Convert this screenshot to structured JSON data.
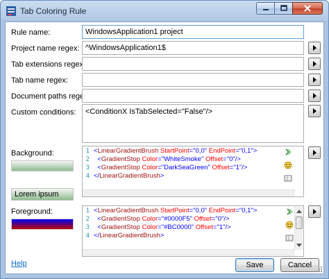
{
  "window": {
    "title": "Tab Coloring Rule"
  },
  "fields": {
    "rule_name": {
      "label": "Rule name:",
      "value": "WindowsApplication1 project"
    },
    "project_regex": {
      "label": "Project name regex:",
      "value": "^WindowsApplication1$"
    },
    "tab_ext_regex": {
      "label": "Tab extensions regex:",
      "value": ""
    },
    "tab_name_regex": {
      "label": "Tab name regex:",
      "value": ""
    },
    "doc_paths_regex": {
      "label": "Document paths regex:",
      "value": ""
    },
    "custom_conditions": {
      "label": "Custom conditions:",
      "value": "<ConditionX IsTabSelected=\"False\"/>"
    }
  },
  "background": {
    "label": "Background:",
    "sample_text": "Lorem ipsum",
    "line_numbers": [
      "1",
      "2",
      "3",
      "4"
    ],
    "lines": [
      [
        [
          "brk",
          "<"
        ],
        [
          "tag",
          "LinearGradientBrush"
        ],
        [
          "att",
          " StartPoint"
        ],
        [
          "brk",
          "=\""
        ],
        [
          "val",
          "0,0"
        ],
        [
          "brk",
          "\""
        ],
        [
          "att",
          " EndPoint"
        ],
        [
          "brk",
          "=\""
        ],
        [
          "val",
          "0,1"
        ],
        [
          "brk",
          "\">"
        ]
      ],
      [
        [
          "sp",
          "  "
        ],
        [
          "brk",
          "<"
        ],
        [
          "tag",
          "GradientStop"
        ],
        [
          "att",
          " Color"
        ],
        [
          "brk",
          "=\""
        ],
        [
          "val",
          "WhiteSmoke"
        ],
        [
          "brk",
          "\""
        ],
        [
          "att",
          " Offset"
        ],
        [
          "brk",
          "=\""
        ],
        [
          "val",
          "0"
        ],
        [
          "brk",
          "\"/>"
        ]
      ],
      [
        [
          "sp",
          "  "
        ],
        [
          "brk",
          "<"
        ],
        [
          "tag",
          "GradientStop"
        ],
        [
          "att",
          " Color"
        ],
        [
          "brk",
          "=\""
        ],
        [
          "val",
          "DarkSeaGreen"
        ],
        [
          "brk",
          "\""
        ],
        [
          "att",
          " Offset"
        ],
        [
          "brk",
          "=\""
        ],
        [
          "val",
          "1"
        ],
        [
          "brk",
          "\"/>"
        ]
      ],
      [
        [
          "brk",
          "</"
        ],
        [
          "tag",
          "LinearGradientBrush"
        ],
        [
          "brk",
          ">"
        ]
      ]
    ]
  },
  "foreground": {
    "label": "Foreground:",
    "line_numbers": [
      "1",
      "2",
      "3",
      "4"
    ],
    "lines": [
      [
        [
          "brk",
          "<"
        ],
        [
          "tag",
          "LinearGradientBrush"
        ],
        [
          "att",
          " StartPoint"
        ],
        [
          "brk",
          "=\""
        ],
        [
          "val",
          "0,0"
        ],
        [
          "brk",
          "\""
        ],
        [
          "att",
          " EndPoint"
        ],
        [
          "brk",
          "=\""
        ],
        [
          "val",
          "0,1"
        ],
        [
          "brk",
          "\">"
        ]
      ],
      [
        [
          "sp",
          "  "
        ],
        [
          "brk",
          "<"
        ],
        [
          "tag",
          "GradientStop"
        ],
        [
          "att",
          " Color"
        ],
        [
          "brk",
          "=\""
        ],
        [
          "val",
          "#0000F5"
        ],
        [
          "brk",
          "\""
        ],
        [
          "att",
          " Offset"
        ],
        [
          "brk",
          "=\""
        ],
        [
          "val",
          "0"
        ],
        [
          "brk",
          "\"/>"
        ]
      ],
      [
        [
          "sp",
          "  "
        ],
        [
          "brk",
          "<"
        ],
        [
          "tag",
          "GradientStop"
        ],
        [
          "att",
          " Color"
        ],
        [
          "brk",
          "=\""
        ],
        [
          "val",
          "#BC0000"
        ],
        [
          "brk",
          "\""
        ],
        [
          "att",
          " Offset"
        ],
        [
          "brk",
          "=\""
        ],
        [
          "val",
          "1"
        ],
        [
          "brk",
          "\"/>"
        ]
      ],
      [
        [
          "brk",
          "</"
        ],
        [
          "tag",
          "LinearGradientBrush"
        ],
        [
          "brk",
          ">"
        ]
      ]
    ]
  },
  "footer": {
    "help_link": "Help",
    "save_label": "Save",
    "cancel_label": "Cancel"
  },
  "colors": {
    "bg_start": "#F5F5F5",
    "bg_end": "#8FBC8F",
    "fg_start": "#0000F5",
    "fg_end": "#BC0000",
    "title_bar": "#B4CBE6"
  },
  "icons": [
    "app-icon",
    "minimize-icon",
    "maximize-icon",
    "close-icon",
    "arrow-right-icon",
    "chevron-icon",
    "smiley-icon",
    "table-icon"
  ]
}
